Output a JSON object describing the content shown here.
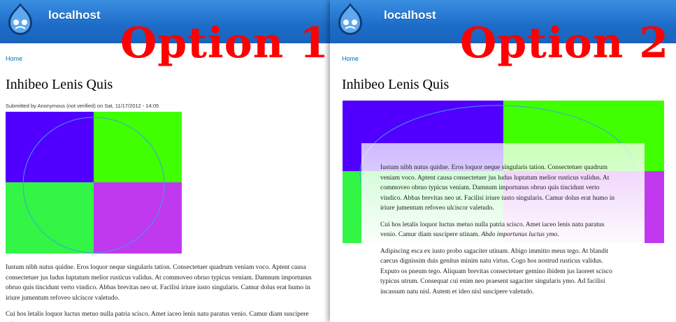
{
  "colors": {
    "header": "#1c6cc8",
    "link": "#0071b3",
    "option_label": "#ff0000",
    "quad_top_left": "#5100ff",
    "quad_top_right": "#40ff00",
    "quad_bottom_left": "#33f546",
    "quad_bottom_right": "#c039ee"
  },
  "option1": {
    "site_name": "localhost",
    "label": "Option 1",
    "breadcrumb": "Home",
    "title": "Inhibeo Lenis Quis",
    "submitted": "Submitted by Anonymous (not verified) on Sat, 11/17/2012 - 14:05",
    "paragraphs": [
      "Iustum nibh nutus quidne. Eros loquor neque singularis tation. Consectetuer quadrum veniam voco. Aptent causa consectetuer jus ludus luptatum melior rusticus validus. At commoveo obruo typicus veniam. Damnum importunus obruo quis tincidunt verto vindico. Abbas brevitas neo ut. Facilisi iriure iusto singularis. Camur dolus erat humo in iriure jumentum refoveo ulciscor valetudo.",
      "Cui hos letalis loquor luctus metuo nulla patria scisco. Amet iaceo lenis natu paratus venio. Camur diam suscipere utinam."
    ]
  },
  "option2": {
    "site_name": "localhost",
    "label": "Option 2",
    "breadcrumb": "Home",
    "title": "Inhibeo Lenis Quis",
    "paragraph1": "Iustum nibh nutus quidne. Eros loquor neque singularis tation. Consectetuer quadrum veniam voco. Aptent causa consectetuer jus ludus luptatum melior rusticus validus. At commoveo obruo typicus veniam. Damnum importunus obruo quis tincidunt verto vindico. Abbas brevitas neo ut. Facilisi iriure iusto singularis. Camur dolus erat humo in iriure jumentum refoveo ulciscor valetudo.",
    "paragraph2_main": "Cui hos letalis loquor luctus metuo nulla patria scisco. Amet iaceo lenis natu paratus venio. Camur diam suscipere utinam. ",
    "paragraph2_em": "Abdo importunus luctus ymo",
    "paragraph2_end": ".",
    "paragraph3": "Adipiscing esca ex iusto probo sagaciter utinam. Abigo immitto meus tego. At blandit caecus dignissim duis genitus minim natu virtus. Cogo hos nostrud rusticus validus. Exputo os pneum tego. Aliquam brevitas consectetuer gemino ibidem jus laoreet scisco typicus utrum. Consequat cui enim neo praesent sagaciter singularis ymo. Ad facilisi incassum natu nisl. Autem et ideo nisl suscipere valetudo."
  }
}
